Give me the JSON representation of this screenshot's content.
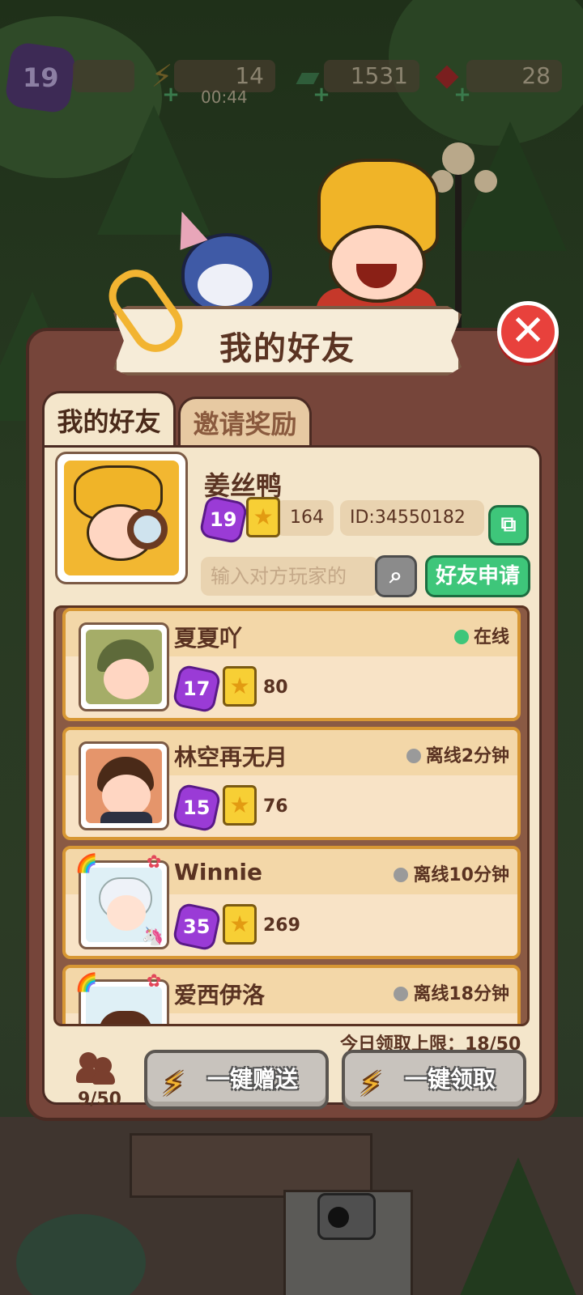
{
  "hud": {
    "level": "19",
    "energy": "14",
    "energy_timer": "00:44",
    "cash": "1531",
    "gems": "28",
    "energy_icon": "lightning-icon",
    "cash_icon": "cash-icon",
    "gem_icon": "ruby-icon"
  },
  "panel": {
    "title": "我的好友",
    "close_icon": "close-icon"
  },
  "tabs": [
    {
      "label": "我的好友",
      "active": true
    },
    {
      "label": "邀请奖励",
      "active": false
    }
  ],
  "profile": {
    "name": "姜丝鸭",
    "level": "19",
    "stars": "164",
    "id_text": "ID:34550182",
    "search_placeholder": "输入对方玩家的",
    "request_button": "好友申请"
  },
  "friends": [
    {
      "name": "夏夏吖",
      "status": "在线",
      "online": true,
      "level": "17",
      "stars": "80"
    },
    {
      "name": "林空再无月",
      "status": "离线2分钟",
      "online": false,
      "level": "15",
      "stars": "76"
    },
    {
      "name": "Winnie",
      "status": "离线10分钟",
      "online": false,
      "level": "35",
      "stars": "269"
    },
    {
      "name": "爱西伊洛",
      "status": "离线18分钟",
      "online": false,
      "level": "",
      "stars": ""
    }
  ],
  "footer": {
    "limit_text": "今日领取上限：18/50",
    "friend_count": "9/50",
    "send_all": "一键赠送",
    "claim_all": "一键领取"
  },
  "colors": {
    "online": "#3ec67a",
    "offline": "#9a9a9a",
    "close_red": "#e8413c",
    "accent_green": "#3ec67a"
  }
}
